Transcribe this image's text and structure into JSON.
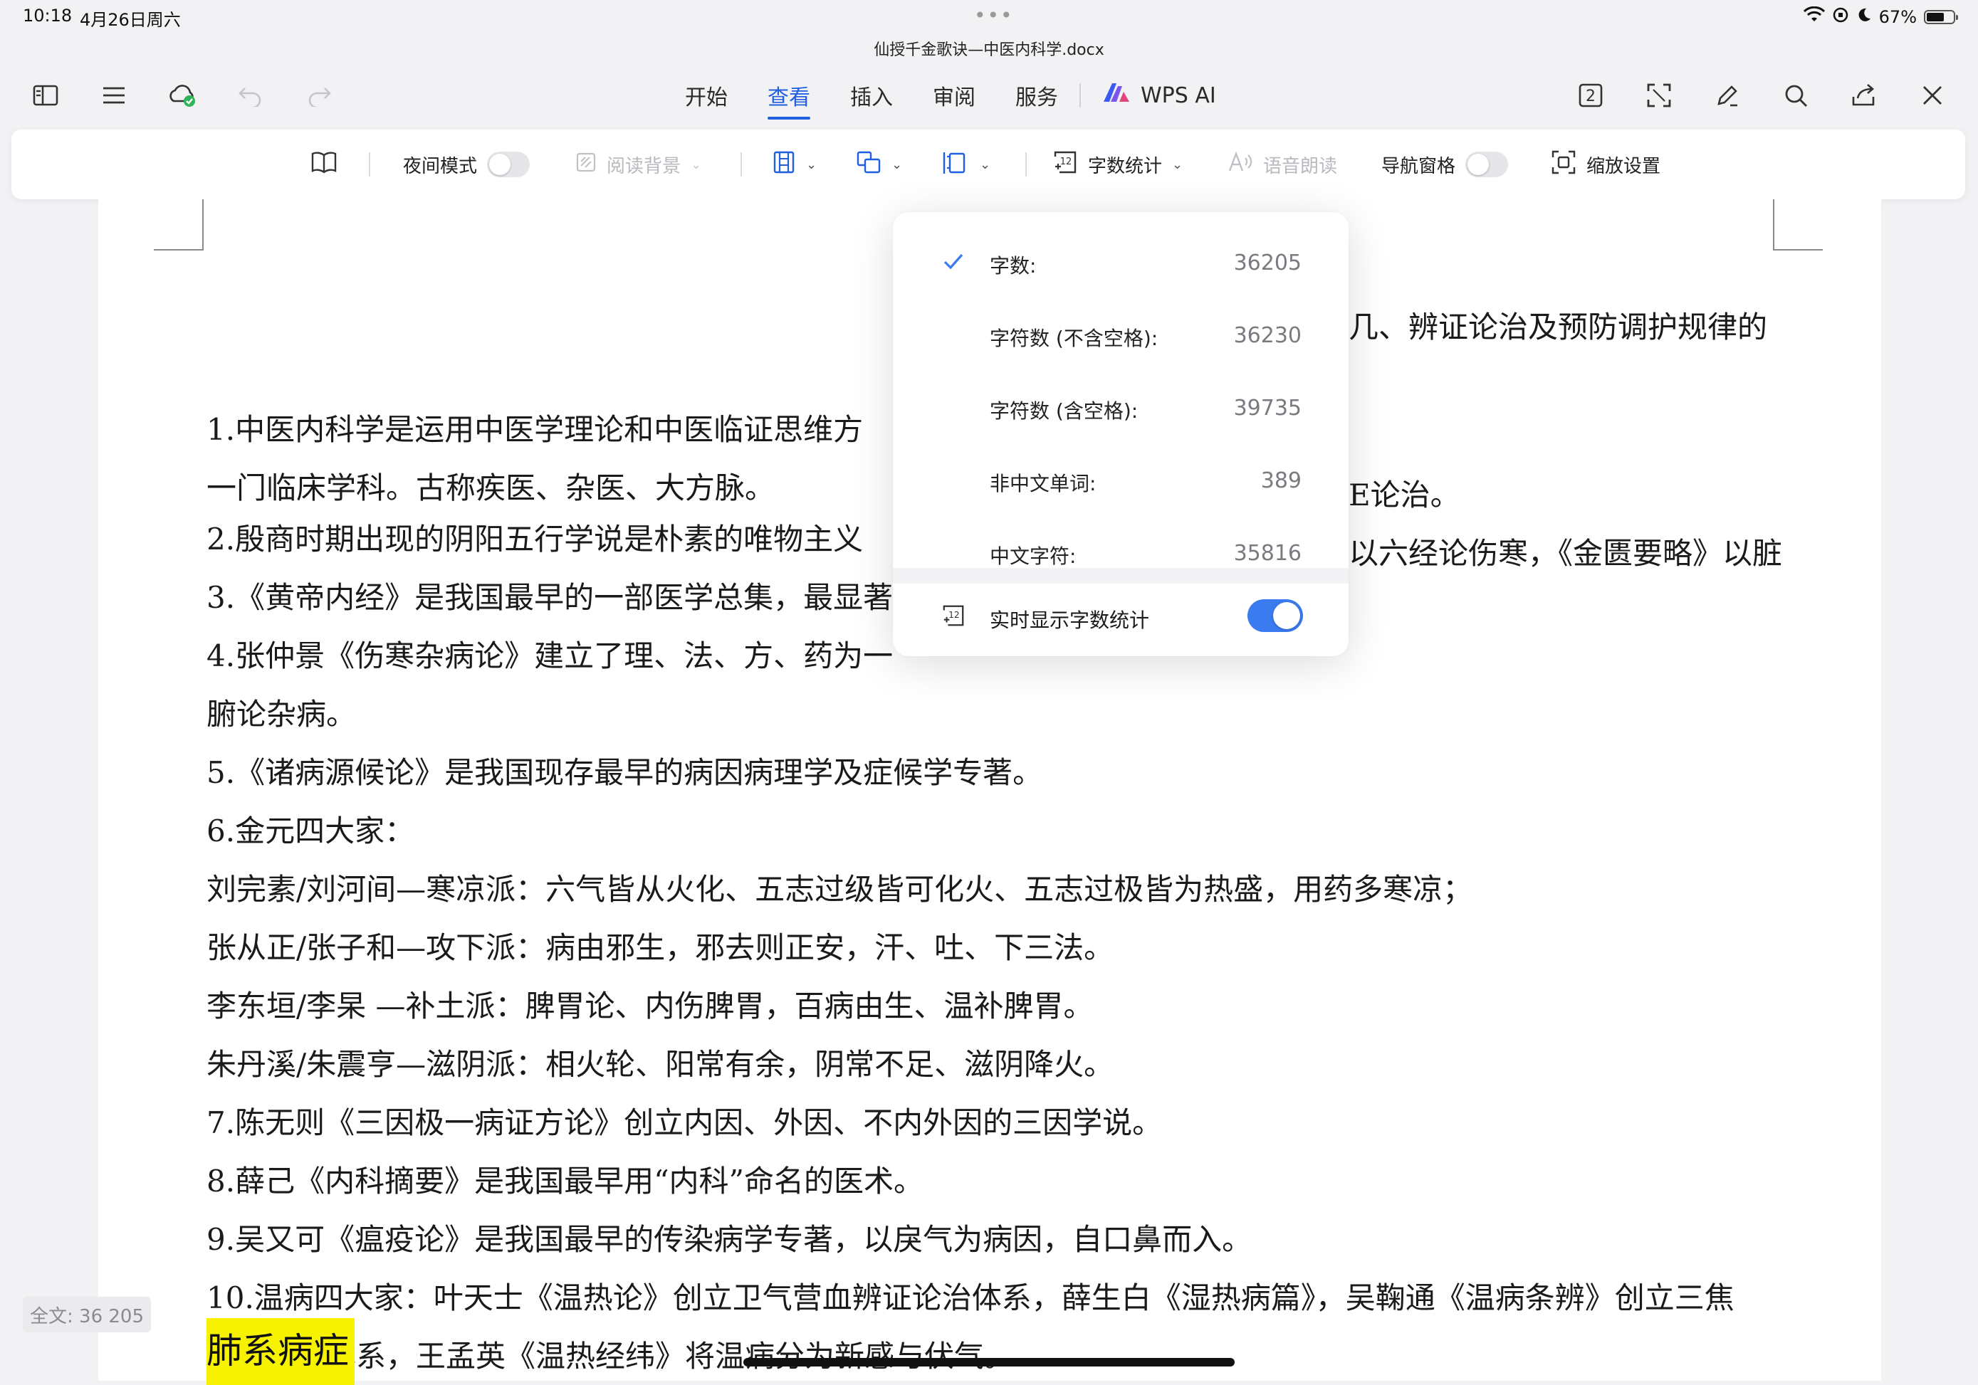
{
  "status_bar": {
    "time": "10:18",
    "date": "4月26日周六",
    "dots": "•••",
    "battery": "67%",
    "battery_level": 0.67
  },
  "document": {
    "title": "仙授千金歌诀—中医内科学.docx",
    "lines": [
      "1.中医内科学是运用中医学理论和中医临证思维方",
      "一门临床学科。古称疾医、杂医、大方脉。",
      "2.殷商时期出现的阴阳五行学说是朴素的唯物主义",
      "3.《黄帝内经》是我国最早的一部医学总集，最显著",
      "4.张仲景《伤寒杂病论》建立了理、法、方、药为一",
      "腑论杂病。",
      "5.《诸病源候论》是我国现存最早的病因病理学及症候学专著。",
      "6.金元四大家：",
      "刘完素/刘河间—寒凉派：六气皆从火化、五志过级皆可化火、五志过极皆为热盛，用药多寒凉；",
      "张从正/张子和—攻下派：病由邪生，邪去则正安，汗、吐、下三法。",
      "李东垣/李杲   —补土派：脾胃论、内伤脾胃，百病由生、温补脾胃。",
      "朱丹溪/朱震亨—滋阴派：相火轮、阳常有余，阴常不足、滋阴降火。",
      "7.陈无则《三因极一病证方论》创立内因、外因、不内外因的三因学说。",
      "8.薛己《内科摘要》是我国最早用“内科”命名的医术。",
      "9.吴又可《瘟疫论》是我国最早的传染病学专著，以戾气为病因，自口鼻而入。",
      "10.温病四大家：叶天士《温热论》创立卫气营血辨证论治体系，薛生白《湿热病篇》，吴鞠通《温病条辨》创立三焦",
      "辨证论治体系，王孟英《温热经纬》将温病分为新感与伏气。"
    ],
    "right_fragments": [
      "几、辨证论治及预防调护规律的",
      "E论治。",
      "以六经论伤寒，《金匮要略》以脏"
    ],
    "heading": "肺系病症"
  },
  "top_tabs": [
    "开始",
    "查看",
    "插入",
    "审阅",
    "服务"
  ],
  "active_tab": "查看",
  "wps_ai": "WPS AI",
  "page_count_badge": "2",
  "ribbon": {
    "night_mode": "夜间模式",
    "reading_bg": "阅读背景",
    "word_count": "字数统计",
    "read_aloud": "语音朗读",
    "nav_pane": "导航窗格",
    "zoom_settings": "缩放设置",
    "word_count_icon": "12"
  },
  "word_count_popup": {
    "rows": [
      {
        "label": "字数:",
        "value": "36205",
        "checked": true
      },
      {
        "label": "字符数 (不含空格):",
        "value": "36230"
      },
      {
        "label": "字符数 (含空格):",
        "value": "39735"
      },
      {
        "label": "非中文单词:",
        "value": "389"
      },
      {
        "label": "中文字符:",
        "value": "35816"
      }
    ],
    "live_label": "实时显示字数统计",
    "live_on": true
  },
  "footer": {
    "full_text": "全文: 36 205"
  },
  "colors": {
    "accent": "#1f5fe0",
    "toggle_on": "#3a7bf0",
    "highlight": "#f6f200"
  }
}
